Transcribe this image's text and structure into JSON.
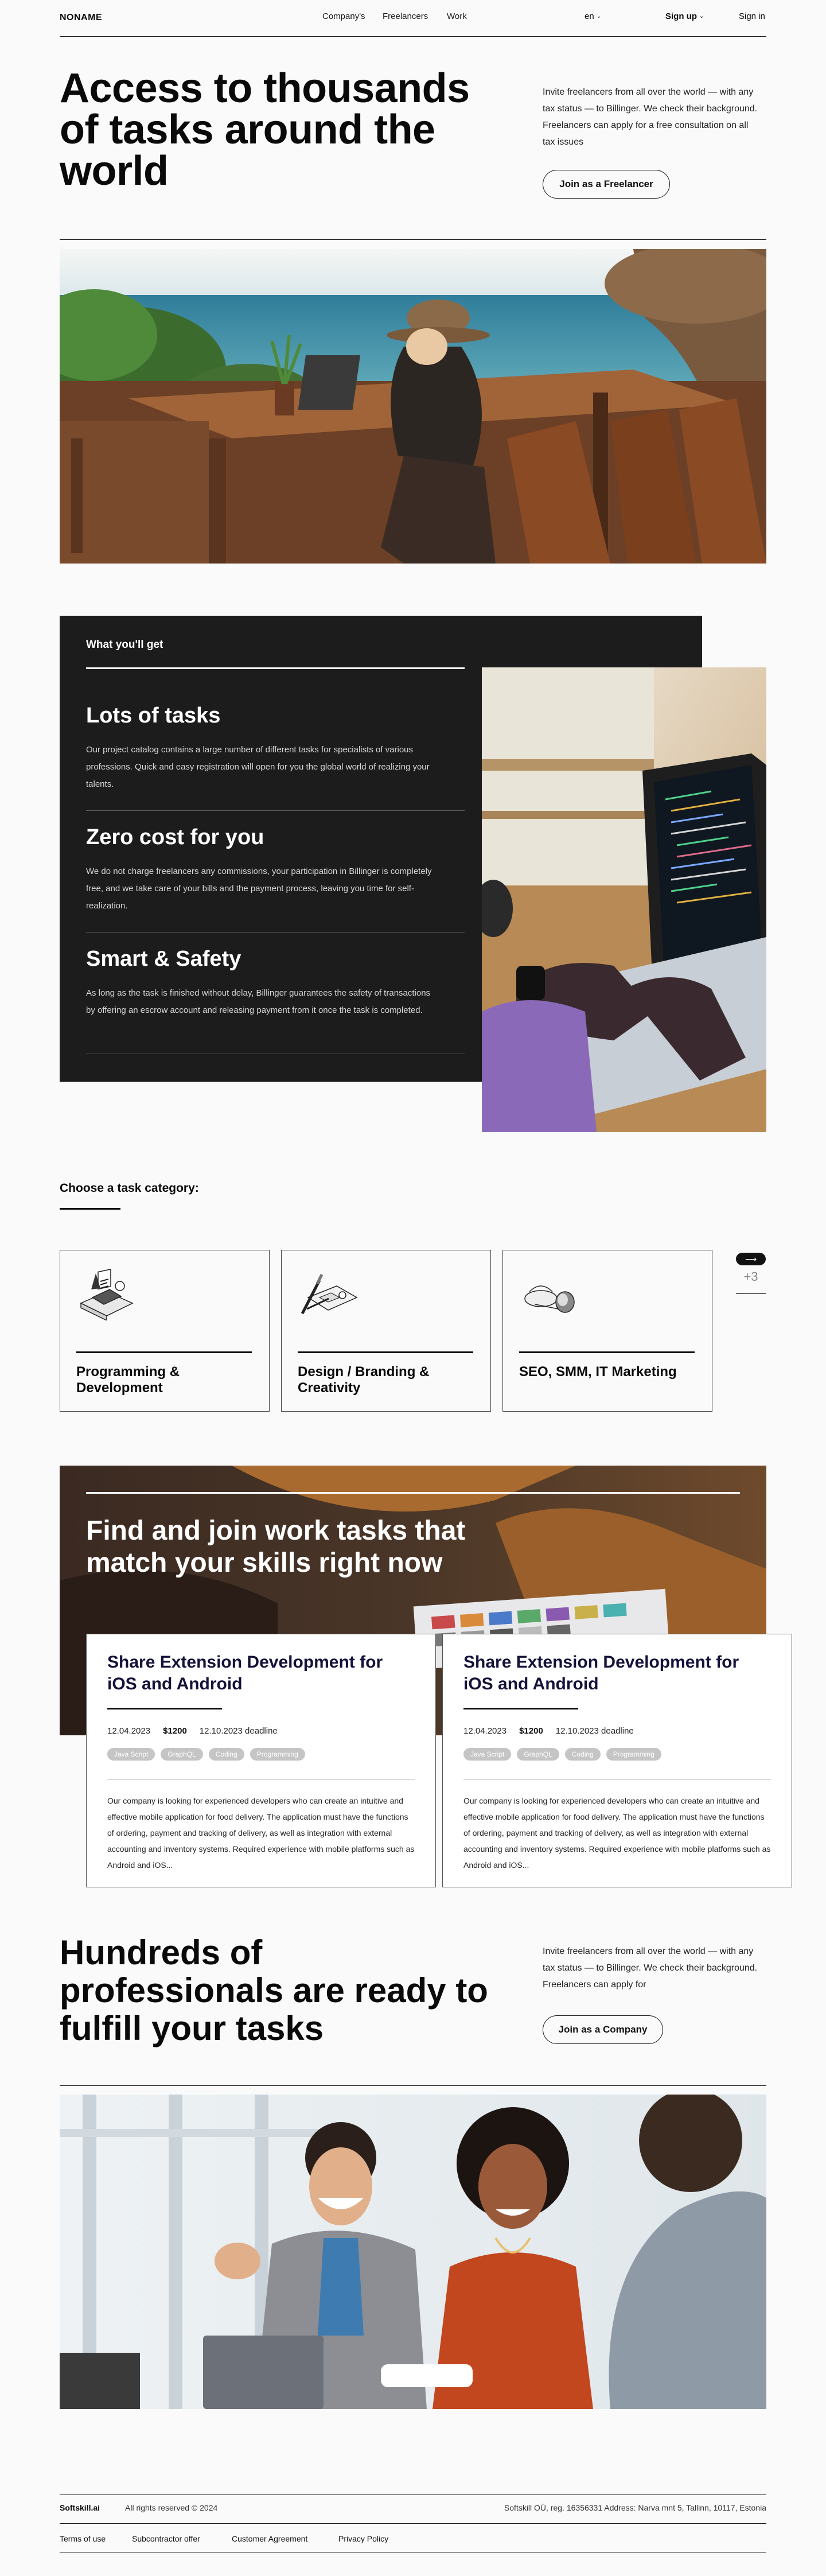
{
  "header": {
    "logo": "NONAME",
    "nav": [
      "Company's",
      "Freelancers",
      "Work"
    ],
    "language": "en",
    "sign_up": "Sign up",
    "sign_in": "Sign in"
  },
  "hero": {
    "title": "Access to thousands of tasks around the world",
    "text": "Invite freelancers from all over the world — with any tax status — to Billinger. We check their background. Freelancers can apply for a free consultation on all tax issues",
    "button": "Join as a Freelancer"
  },
  "benefits": {
    "heading": "What you'll get",
    "items": [
      {
        "title": "Lots of tasks",
        "text": "Our project catalog contains a large number of different tasks for specialists of various professions. Quick and easy registration will open for you the global world of realizing your talents."
      },
      {
        "title": "Zero cost for you",
        "text": "We do not charge freelancers any commissions, your participation in Billinger is completely free, and we take care of your bills and the payment process, leaving you time for self-realization."
      },
      {
        "title": "Smart & Safety",
        "text": "As long as the task is finished without delay, Billinger guarantees the safety of transactions by offering an escrow account and releasing payment from it once the task is completed."
      }
    ]
  },
  "categories": {
    "heading": "Choose a task category:",
    "items": [
      {
        "label": "Programming & Development",
        "icon": "programming-illustration-icon"
      },
      {
        "label": "Design / Branding & Creativity",
        "icon": "design-illustration-icon"
      },
      {
        "label": "SEO, SMM, IT Marketing",
        "icon": "marketing-illustration-icon"
      }
    ],
    "more": "+3"
  },
  "jobs": {
    "title": "Find and join work tasks that match your skills right now",
    "cards": [
      {
        "title": "Share Extension Development for iOS and Android",
        "date": "12.04.2023",
        "price": "$1200",
        "deadline": "12.10.2023 deadline",
        "tags": [
          "Java Script",
          "GraphQL",
          "Coding",
          "Programming"
        ],
        "description": "Our company is looking for experienced developers who can create an intuitive and effective mobile application for food delivery. The application must have the functions of ordering, payment and tracking of delivery, as well as integration with external accounting and inventory systems. Required experience with mobile platforms such as Android and iOS..."
      },
      {
        "title": "Share Extension Development for iOS and Android",
        "date": "12.04.2023",
        "price": "$1200",
        "deadline": "12.10.2023 deadline",
        "tags": [
          "Java Script",
          "GraphQL",
          "Coding",
          "Programming"
        ],
        "description": "Our company is looking for experienced developers who can create an intuitive and effective mobile application for food delivery. The application must have the functions of ordering, payment and tracking of delivery, as well as integration with external accounting and inventory systems. Required experience with mobile platforms such as Android and iOS..."
      }
    ]
  },
  "professionals": {
    "title": "Hundreds of professionals are ready to fulfill your tasks",
    "text": "Invite freelancers from all over the world — with any tax status — to Billinger. We check their background. Freelancers can apply for",
    "button": "Join as a Company"
  },
  "footer": {
    "brand": "Softskill.ai",
    "rights": "All rights reserved © 2024",
    "company": "Softskill OÜ, reg. 16356331 Address: Narva mnt 5, Tallinn, 10117, Estonia",
    "links": [
      "Terms of use",
      "Subcontractor offer",
      "Customer Agreement",
      "Privacy Policy"
    ]
  },
  "colors": {
    "dark_panel": "#1c1c1c",
    "ink": "#0a0a0a",
    "job_title": "#14123a",
    "tag": "#c5c5c5"
  }
}
